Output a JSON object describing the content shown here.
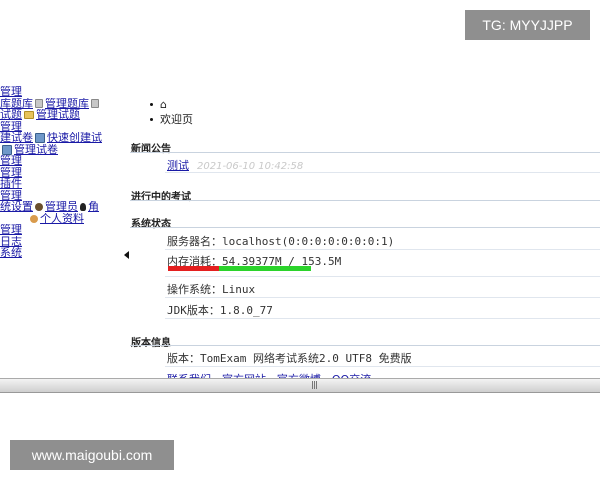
{
  "watermarks": {
    "telegram": "TG: MYYJJPP",
    "site": "www.maigoubi.com"
  },
  "sidebar": {
    "rows": [
      {
        "label": "管理"
      },
      {
        "label": "库题库",
        "extra": "管理题库"
      },
      {
        "label": "试题",
        "extra": "管理试题"
      },
      {
        "label": "管理"
      },
      {
        "label": "建试卷",
        "extra": "快速创建试"
      },
      {
        "label": "管理试卷"
      },
      {
        "label": "管理"
      },
      {
        "label": "管理"
      },
      {
        "label": "插件"
      },
      {
        "label": "管理"
      },
      {
        "label": "统设置",
        "extra": "管理员",
        "extra2": "角"
      },
      {
        "label": "个人资料"
      },
      {
        "label": "管理"
      },
      {
        "label": "日志"
      },
      {
        "label": "系统"
      }
    ]
  },
  "topnav": {
    "home_icon": "home-icon",
    "welcome": "欢迎页"
  },
  "news": {
    "title": "新闻公告",
    "item_label": "测试",
    "item_date": "2021-06-10 10:42:58"
  },
  "ongoing": {
    "title": "进行中的考试"
  },
  "system": {
    "title": "系统状态",
    "server_name": "服务器名：localhost(0:0:0:0:0:0:0:1)",
    "memory": "内存消耗：54.39377M / 153.5M",
    "memory_used_ratio": 0.354,
    "os": "操作系统：Linux",
    "jdk": "JDK版本：1.8.0_77"
  },
  "version": {
    "title": "版本信息",
    "text": "版本：TomExam 网络考试系统2.0 UTF8 免费版",
    "links": "联系我们 - 官方网站 - 官方微博 - QQ交流"
  },
  "colors": {
    "link": "#1a1aa6",
    "mem_used": "#e41f1f",
    "mem_free": "#2bd32b"
  }
}
